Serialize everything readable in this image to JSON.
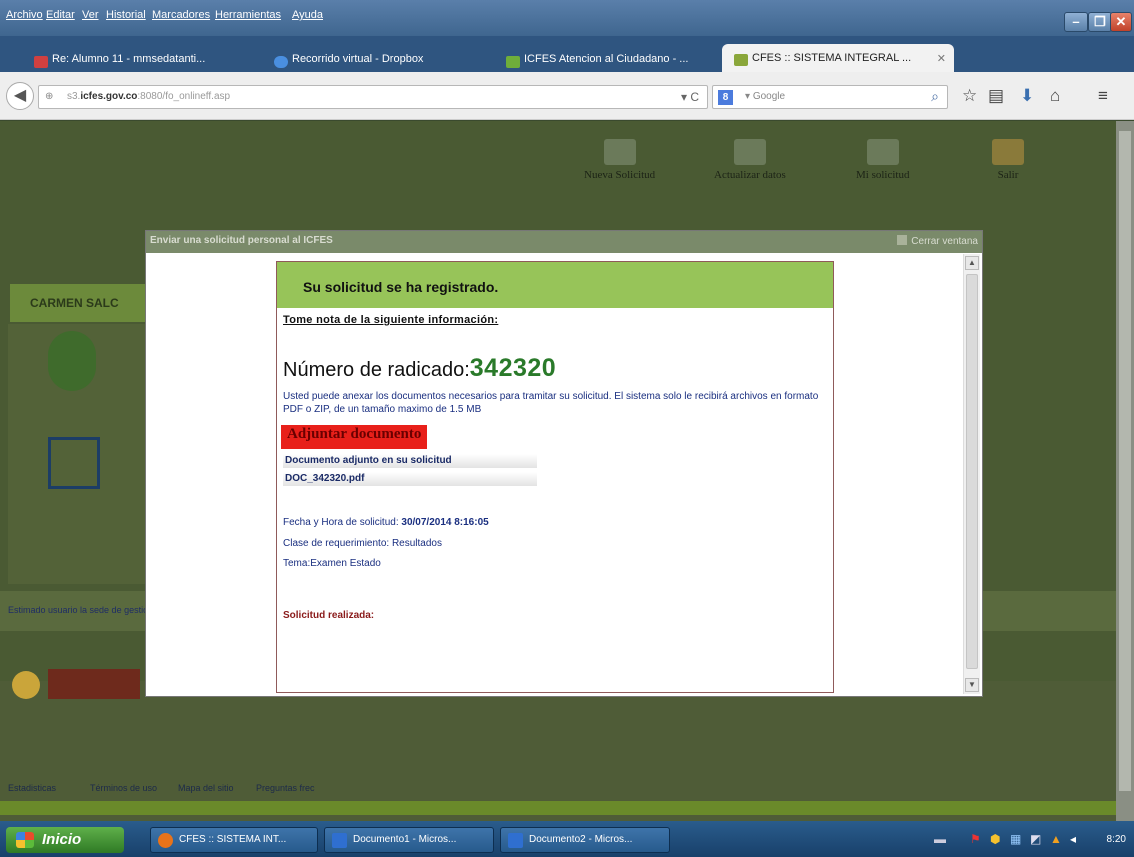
{
  "menubar": {
    "items": [
      "Archivo",
      "Editar",
      "Ver",
      "Historial",
      "Marcadores",
      "Herramientas",
      "Ayuda"
    ]
  },
  "tabs": [
    {
      "label": "Re: Alumno 11 - mmsedatanti...",
      "icon": "mail-icon",
      "color": "#d04040"
    },
    {
      "label": "Recorrido virtual - Dropbox",
      "icon": "dropbox-icon",
      "color": "#4a8fe0"
    },
    {
      "label": "ICFES Atencion al Ciudadano - ...",
      "icon": "checkbox-icon",
      "color": "#6fae3a"
    },
    {
      "label": "CFES :: SISTEMA INTEGRAL ...",
      "icon": "favicon-icon",
      "color": "#8aa63a"
    }
  ],
  "nav": {
    "url_host": "icfes.gov.co",
    "url_prefix": "s3.",
    "url_path": ":8080/fo_onlineff.asp",
    "search_placeholder": "Google",
    "search_engine_letter": "8"
  },
  "page_bg": {
    "nav_items": [
      "Nueva Solicitud",
      "Actualizar datos",
      "Mi solicitud",
      "Salir"
    ],
    "user_name": "CARMEN SALC",
    "band_text": "Estimado usuario la sede de gestio",
    "footer_links": [
      "Estadisticas",
      "Términos de uso",
      "Mapa del sitio",
      "Preguntas frec"
    ]
  },
  "modal": {
    "title": "Enviar una solicitud personal al ICFES",
    "close_label": "Cerrar ventana",
    "header": "Su solicitud se ha registrado.",
    "note": "Tome nota de la siguiente información:",
    "radicado_label": "Número de radicado:",
    "radicado_number": "342320",
    "description": "Usted puede anexar los documentos necesarios para tramitar su solicitud. El sistema solo le recibirá archivos en formato PDF o ZIP, de un tamaño maximo de 1.5 MB",
    "attach_button": "Adjuntar documento",
    "doc_header": "Documento adjunto en su solicitud",
    "doc_file": "DOC_342320.pdf",
    "fecha_label": "Fecha y Hora de solicitud:",
    "fecha_value": "30/07/2014 8:16:05",
    "clase_label": "Clase de requerimiento:",
    "clase_value": "Resultados",
    "tema_label": "Tema:",
    "tema_value": "Examen Estado",
    "status": "Solicitud realizada:"
  },
  "taskbar": {
    "start_label": "Inicio",
    "items": [
      {
        "label": "CFES :: SISTEMA INT...",
        "color": "#e8731a"
      },
      {
        "label": "Documento1 - Micros...",
        "color": "#2f6fd0"
      },
      {
        "label": "Documento2 - Micros...",
        "color": "#2f6fd0"
      }
    ],
    "clock": "8:20"
  }
}
